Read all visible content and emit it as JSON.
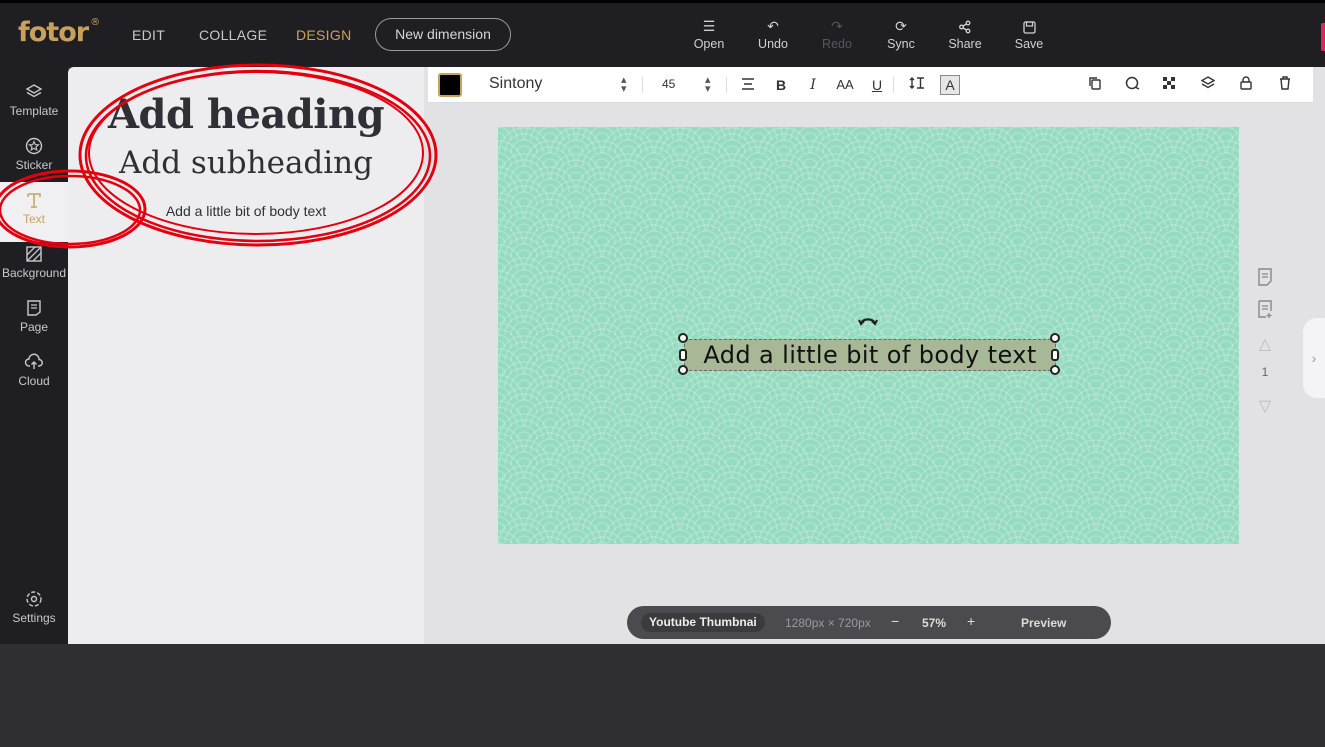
{
  "app": {
    "logo": "fotor",
    "logo_mark": "®",
    "nav": [
      "EDIT",
      "COLLAGE",
      "DESIGN"
    ],
    "active_nav": "DESIGN",
    "new_dimension_label": "New dimension",
    "tools": [
      {
        "label": "Open",
        "icon": "menu-icon"
      },
      {
        "label": "Undo",
        "icon": "undo-icon"
      },
      {
        "label": "Redo",
        "icon": "redo-icon"
      },
      {
        "label": "Sync",
        "icon": "sync-icon"
      },
      {
        "label": "Share",
        "icon": "share-icon"
      },
      {
        "label": "Save",
        "icon": "save-icon"
      }
    ]
  },
  "sidebar": {
    "items": [
      {
        "label": "Template",
        "icon": "layers-icon"
      },
      {
        "label": "Sticker",
        "icon": "sticker-icon"
      },
      {
        "label": "Text",
        "icon": "text-icon"
      },
      {
        "label": "Background",
        "icon": "background-icon"
      },
      {
        "label": "Page",
        "icon": "page-icon"
      },
      {
        "label": "Cloud",
        "icon": "cloud-upload-icon"
      }
    ],
    "active": "Text",
    "settings_label": "Settings"
  },
  "text_panel": {
    "heading": "Add heading",
    "subheading": "Add subheading",
    "body": "Add a little bit of body text"
  },
  "toolbar": {
    "color": "#000000",
    "font": "Sintony",
    "font_size": "45",
    "style_buttons": [
      "B",
      "I",
      "AA",
      "U"
    ],
    "boxed_label": "A"
  },
  "canvas": {
    "background_color": "#95dbbe",
    "selected_text": "Add a little bit of body text"
  },
  "page_controls": {
    "page_number": "1"
  },
  "statusbar": {
    "template_name": "Youtube Thumbnai",
    "dimensions": "1280px × 720px",
    "minus": "−",
    "zoom": "57%",
    "plus": "+",
    "preview": "Preview"
  },
  "colors": {
    "accent": "#c9a15d",
    "header_bg": "#1f1f23",
    "annotation_red": "#e3000f"
  }
}
